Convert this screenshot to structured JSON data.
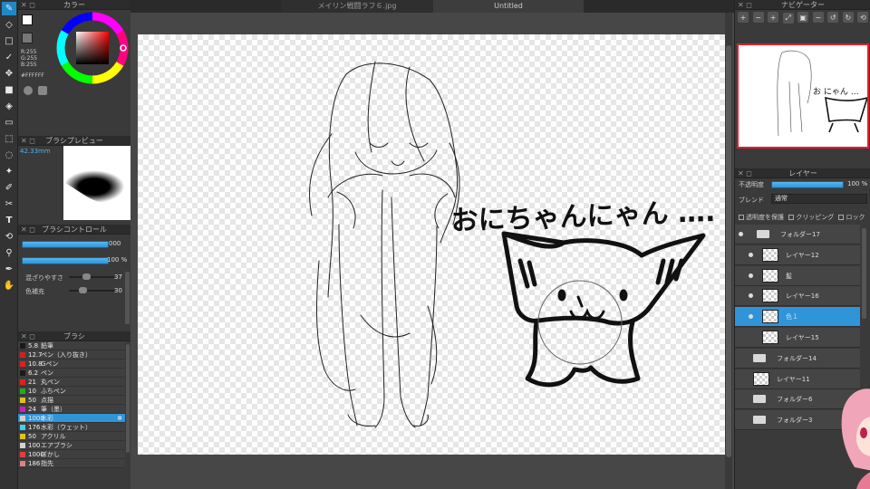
{
  "tabs": [
    {
      "label": "メイリン戦闘ラフ６.jpg"
    },
    {
      "label": "Untitled"
    }
  ],
  "color_panel": {
    "title": "カラー",
    "r": "R:255",
    "g": "G:255",
    "b": "B:255",
    "hex": "#FFFFFF"
  },
  "brush_preview": {
    "title": "ブラシプレビュー",
    "size": "42.33mm"
  },
  "brush_control": {
    "title": "ブラシコントロール",
    "size_value": "000",
    "opacity_value": "100 %",
    "blend_label": "混ざりやすさ",
    "blend_value": "37",
    "fill_label": "色補充",
    "fill_value": "30",
    "size_level": 1.0,
    "opacity_level": 1.0,
    "blend_level": 0.37,
    "fill_level": 0.3
  },
  "brush_list": {
    "title": "ブラシ",
    "items": [
      {
        "size": "5.8",
        "name": "鉛筆",
        "color": "#1a1a1a"
      },
      {
        "size": "12.7",
        "name": "ペン（入り抜き）",
        "color": "#cc2222"
      },
      {
        "size": "10.8",
        "name": "Gペン",
        "color": "#e02020"
      },
      {
        "size": "6.2",
        "name": "ペン",
        "color": "#1a1a1a"
      },
      {
        "size": "21",
        "name": "丸ペン",
        "color": "#e02020"
      },
      {
        "size": "10",
        "name": "ふちペン",
        "color": "#22aa22"
      },
      {
        "size": "50",
        "name": "点描",
        "color": "#e0c020"
      },
      {
        "size": "24",
        "name": "筆（墨）",
        "color": "#c020c0"
      },
      {
        "size": "1000",
        "name": "水彩",
        "color": "#d0d0d0"
      },
      {
        "size": "176",
        "name": "水彩（ウェット）",
        "color": "#40d0f0"
      },
      {
        "size": "50",
        "name": "アクリル",
        "color": "#e0c020"
      },
      {
        "size": "100",
        "name": "エアブラシ",
        "color": "#d0d0d0"
      },
      {
        "size": "1000",
        "name": "ぼかし",
        "color": "#e04040"
      },
      {
        "size": "186",
        "name": "指先",
        "color": "#e08080"
      }
    ]
  },
  "navigator": {
    "title": "ナビゲーター"
  },
  "layers_panel": {
    "title": "レイヤー",
    "opacity_label": "不透明度",
    "opacity_value": "100 %",
    "opacity_level": 1.0,
    "blend_label": "ブレンド",
    "blend_value": "通常",
    "protect_label": "透明度を保護",
    "clipping_label": "クリッピング",
    "lock_label": "ロック",
    "layers": [
      {
        "name": "フォルダー17",
        "kind": "folder"
      },
      {
        "name": "レイヤー12",
        "kind": "layer"
      },
      {
        "name": "髪",
        "kind": "layer"
      },
      {
        "name": "レイヤー16",
        "kind": "layer"
      },
      {
        "name": "色１",
        "kind": "layer"
      },
      {
        "name": "レイヤー15",
        "kind": "layer"
      },
      {
        "name": "フォルダー14",
        "kind": "folder"
      },
      {
        "name": "レイヤー11",
        "kind": "layer"
      },
      {
        "name": "フォルダー6",
        "kind": "folder"
      },
      {
        "name": "フォルダー3",
        "kind": "folder"
      }
    ]
  },
  "canvas_text": "おにちゃんにゃん …."
}
